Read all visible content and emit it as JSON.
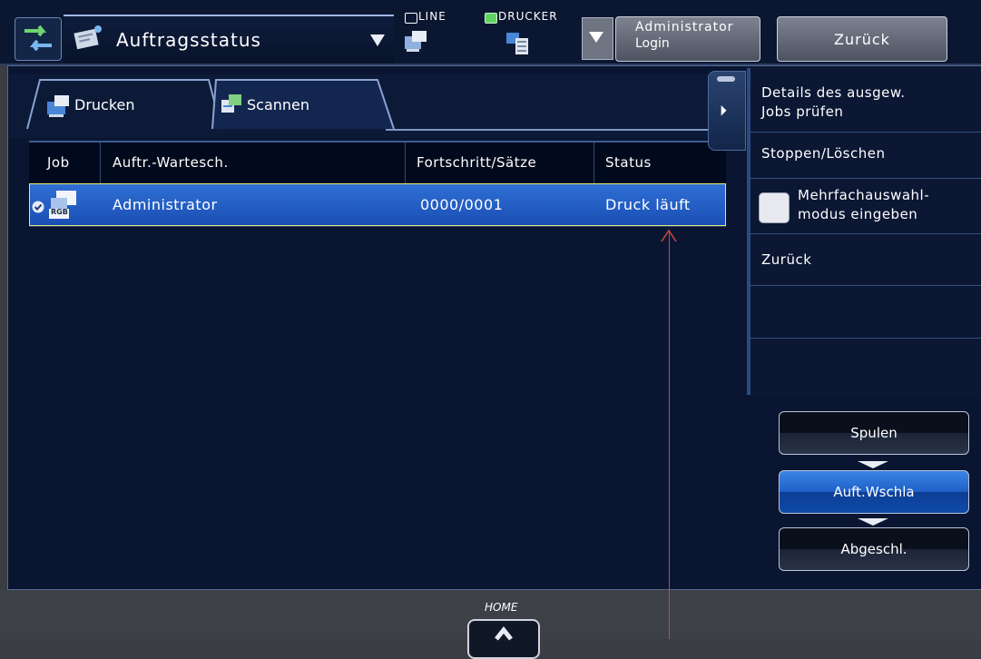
{
  "header": {
    "mode_title": "Auftragsstatus",
    "line_label": "LINE",
    "printer_label": "DRUCKER",
    "admin_line1": "Administrator",
    "admin_line2": "Login",
    "back_label": "Zurück"
  },
  "tabs": [
    {
      "label": "Drucken",
      "active": true
    },
    {
      "label": "Scannen",
      "active": false
    }
  ],
  "table": {
    "columns": [
      "Job",
      "Auftr.-Wartesch.",
      "Fortschritt/Sätze",
      "Status"
    ],
    "rows": [
      {
        "job_badge": "RGB",
        "queue": "Administrator",
        "progress": "0000/0001",
        "status": "Druck läuft",
        "selected": true
      }
    ]
  },
  "side_panel": {
    "items": [
      {
        "label_l1": "Details des ausgew.",
        "label_l2": "Jobs prüfen"
      },
      {
        "label_l1": "Stoppen/Löschen"
      },
      {
        "label_l1": "Mehrfachauswahl-",
        "label_l2": "modus eingeben",
        "checkbox": true
      },
      {
        "label_l1": "Zurück"
      }
    ]
  },
  "queue_buttons": [
    {
      "label": "Spulen",
      "active": false
    },
    {
      "label": "Auft.Wschla",
      "active": true
    },
    {
      "label": "Abgeschl.",
      "active": false
    }
  ],
  "footer": {
    "home_label": "HOME"
  },
  "colors": {
    "background": "#0a1631",
    "selected_row": "#1a4fb5",
    "selected_border": "#e3ea7a",
    "annotation_line": "#d2443b"
  }
}
